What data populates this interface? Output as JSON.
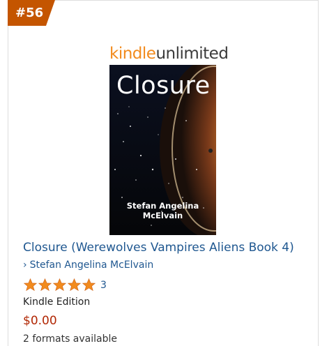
{
  "rank": {
    "label": "#56",
    "color": "#c45500"
  },
  "badge": {
    "kindle": "kindle",
    "unlimited": "unlimited"
  },
  "cover": {
    "title": "Closure",
    "author": "Stefan Angelina McElvain"
  },
  "product": {
    "title": "Closure (Werewolves Vampires Aliens Book 4)",
    "author": "Stefan Angelina McElvain",
    "author_chevron": "›",
    "rating_count": "3",
    "stars": 5,
    "format": "Kindle Edition",
    "price": "$0.00",
    "formats_available": "2 formats available"
  },
  "colors": {
    "link": "#1f5790",
    "price": "#b12704",
    "star": "#f28b1e"
  }
}
